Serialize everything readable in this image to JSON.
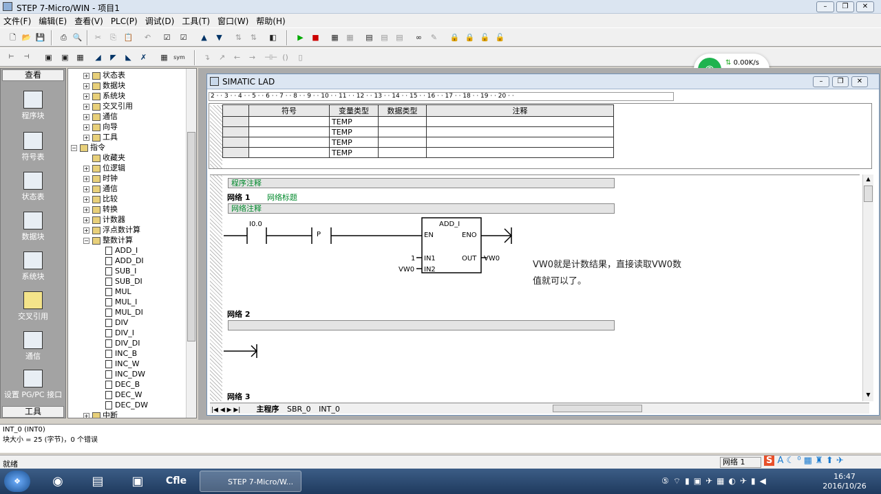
{
  "window": {
    "title": "STEP 7-Micro/WIN - 项目1"
  },
  "menu": [
    "文件(F)",
    "编辑(E)",
    "查看(V)",
    "PLC(P)",
    "调试(D)",
    "工具(T)",
    "窗口(W)",
    "帮助(H)"
  ],
  "nav": {
    "header": "查看",
    "footer": "工具",
    "items": [
      "程序块",
      "符号表",
      "状态表",
      "数据块",
      "系统块",
      "交叉引用",
      "通信",
      "设置 PG/PC 接口"
    ]
  },
  "tree": {
    "top": [
      "状态表",
      "数据块",
      "系统块",
      "交叉引用",
      "通信",
      "向导",
      "工具"
    ],
    "instr": "指令",
    "instr_children": [
      "收藏夹",
      "位逻辑",
      "时钟",
      "通信",
      "比较",
      "转换",
      "计数器",
      "浮点数计算",
      "整数计算"
    ],
    "int_ops": [
      "ADD_I",
      "ADD_DI",
      "SUB_I",
      "SUB_DI",
      "MUL",
      "MUL_I",
      "MUL_DI",
      "DIV",
      "DIV_I",
      "DIV_DI",
      "INC_B",
      "INC_W",
      "INC_DW",
      "DEC_B",
      "DEC_W",
      "DEC_DW"
    ],
    "last": "中断"
  },
  "editor": {
    "title": "SIMATIC LAD",
    "ruler": "2 · · 3 · · 4 · · 5 · · 6 · · 7 · · 8 · · 9 · · 10 · · 11 · · 12 · · 13 · · 14 · · 15 · · 16 · · 17 · · 18 ·  · 19 · · 20 · ·"
  },
  "vartable": {
    "headers": [
      "符号",
      "变量类型",
      "数据类型",
      "注释"
    ],
    "var_type": "TEMP"
  },
  "ladder": {
    "program_comment": "程序注释",
    "net1": "网络 1",
    "net1_title": "网络标题",
    "net_comment": "网络注释",
    "contact": "I0.0",
    "edge": "P",
    "box": "ADD_I",
    "en": "EN",
    "eno": "ENO",
    "in1": "IN1",
    "in2": "IN2",
    "out": "OUT",
    "in1_val": "1",
    "in2_val": "VW0",
    "out_val": "VW0",
    "net2": "网络 2",
    "net3": "网络 3"
  },
  "annotation": {
    "line1": "VW0就是计数结果，直接读取VW0数",
    "line2": "值就可以了。"
  },
  "tabs": [
    "主程序",
    "SBR_0",
    "INT_0"
  ],
  "output": {
    "line1": "INT_0 (INT0)",
    "line2": "块大小 = 25 (字节)，0 个错误"
  },
  "status": {
    "left": "就绪",
    "net": "网络 1"
  },
  "netwidget": {
    "speed": "0.00K/s",
    "count": "0"
  },
  "taskbar": {
    "app": "STEP 7-Micro/W...",
    "time": "16:47",
    "date": "2016/10/26",
    "cfle": "Cfle"
  }
}
